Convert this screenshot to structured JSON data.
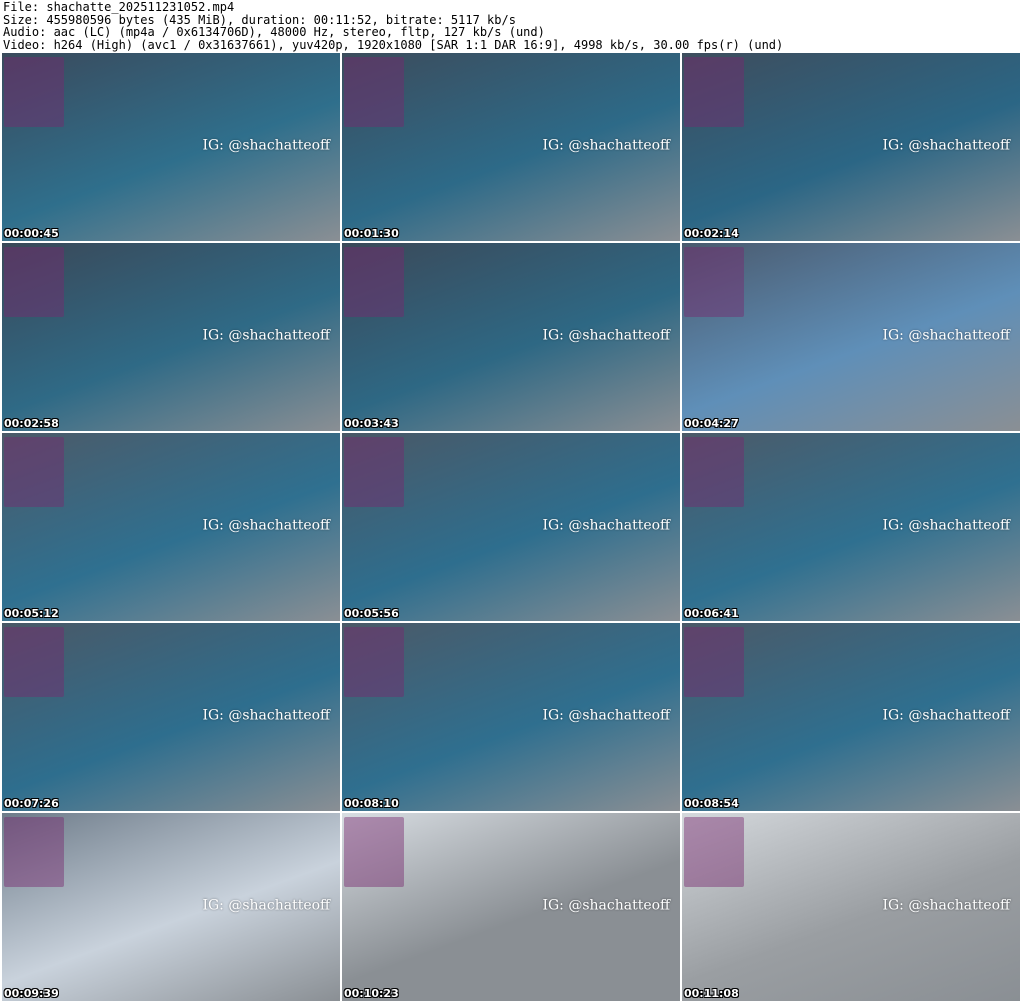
{
  "info": {
    "file": "File: shachatte_202511231052.mp4",
    "size": "Size: 455980596 bytes (435 MiB), duration: 00:11:52, bitrate: 5117 kb/s",
    "audio": "Audio: aac (LC) (mp4a / 0x6134706D), 48000 Hz, stereo, fltp, 127 kb/s (und)",
    "video": "Video: h264 (High) (avc1 / 0x31637661), yuv420p, 1920x1080 [SAR 1:1 DAR 16:9], 4998 kb/s, 30.00 fps(r) (und)"
  },
  "watermark": "IG: @shachatteoff",
  "frames": [
    {
      "time": "00:00:45",
      "colors": [
        "#3a4a5c",
        "#2f6f8c"
      ]
    },
    {
      "time": "00:01:30",
      "colors": [
        "#3c4c5c",
        "#2d6a88"
      ]
    },
    {
      "time": "00:02:14",
      "colors": [
        "#3e4d5d",
        "#2b6685"
      ]
    },
    {
      "time": "00:02:58",
      "colors": [
        "#3a4858",
        "#2f6a86"
      ]
    },
    {
      "time": "00:03:43",
      "colors": [
        "#3b4959",
        "#2e6884"
      ]
    },
    {
      "time": "00:04:27",
      "colors": [
        "#4a5a6e",
        "#5f8fb8"
      ]
    },
    {
      "time": "00:05:12",
      "colors": [
        "#4c5a68",
        "#2f7090"
      ]
    },
    {
      "time": "00:05:56",
      "colors": [
        "#4a5866",
        "#2e6e8e"
      ]
    },
    {
      "time": "00:06:41",
      "colors": [
        "#4c5a68",
        "#2f7090"
      ]
    },
    {
      "time": "00:07:26",
      "colors": [
        "#4a5866",
        "#2e6e8e"
      ]
    },
    {
      "time": "00:08:10",
      "colors": [
        "#4b5967",
        "#2f6f8f"
      ]
    },
    {
      "time": "00:08:54",
      "colors": [
        "#4b5967",
        "#2f6f8f"
      ]
    },
    {
      "time": "00:09:39",
      "colors": [
        "#6e7c8a",
        "#c9d2dc"
      ]
    },
    {
      "time": "00:10:23",
      "colors": [
        "#d8dde2",
        "#8a8f94"
      ]
    },
    {
      "time": "00:11:08",
      "colors": [
        "#d4d8dc",
        "#9a9ea2"
      ]
    }
  ]
}
